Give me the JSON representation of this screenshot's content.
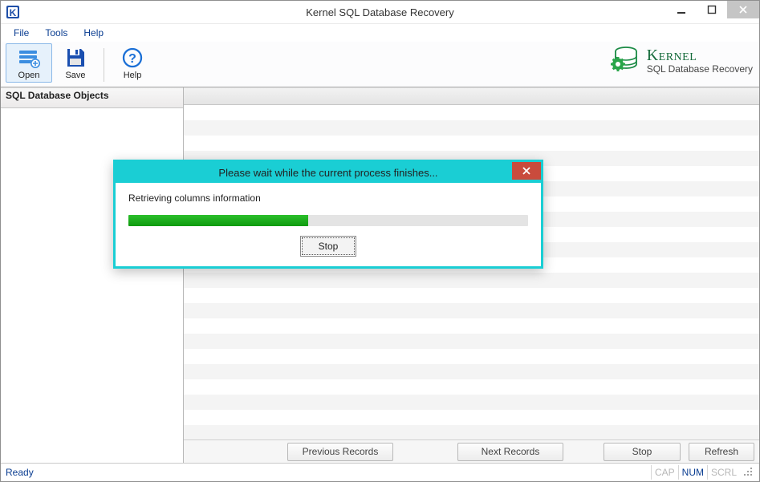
{
  "titlebar": {
    "title": "Kernel SQL Database Recovery"
  },
  "menubar": {
    "items": [
      {
        "label": "File"
      },
      {
        "label": "Tools"
      },
      {
        "label": "Help"
      }
    ]
  },
  "toolbar": {
    "buttons": [
      {
        "id": "open",
        "label": "Open"
      },
      {
        "id": "save",
        "label": "Save"
      },
      {
        "id": "help",
        "label": "Help"
      }
    ]
  },
  "brand": {
    "title": "Kernel",
    "subtitle": "SQL Database Recovery"
  },
  "left_pane": {
    "header": "SQL Database Objects"
  },
  "bottom_buttons": {
    "previous": "Previous Records",
    "next": "Next Records",
    "stop": "Stop",
    "refresh": "Refresh"
  },
  "statusbar": {
    "text": "Ready",
    "indicators": {
      "cap": "CAP",
      "num": "NUM",
      "scrl": "SCRL"
    }
  },
  "modal": {
    "title": "Please wait while the current process finishes...",
    "status_text": "Retrieving columns information",
    "progress_percent": 45,
    "stop_label": "Stop"
  }
}
